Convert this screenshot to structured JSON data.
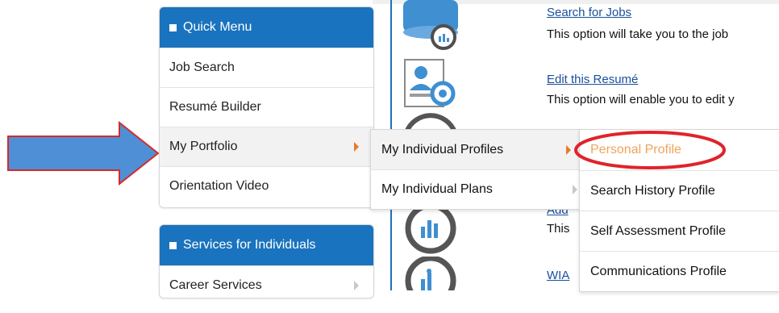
{
  "quick_menu": {
    "title": "Quick Menu",
    "items": [
      {
        "label": "Job Search"
      },
      {
        "label": "Resumé Builder"
      },
      {
        "label": "My Portfolio"
      },
      {
        "label": "Orientation Video"
      }
    ]
  },
  "services_menu": {
    "title": "Services for Individuals",
    "items": [
      {
        "label": "Career Services"
      }
    ]
  },
  "content": {
    "search_jobs": {
      "title": "Search for Jobs",
      "desc": "This option will take you to the job"
    },
    "edit_resume": {
      "title": "Edit this Resumé",
      "desc": "This option will enable you to edit y"
    },
    "add": {
      "title": "Add",
      "desc": "This"
    },
    "wia": {
      "title": "WIA"
    }
  },
  "submenu_portfolio": {
    "items": [
      {
        "label": "My Individual Profiles"
      },
      {
        "label": "My Individual Plans"
      }
    ]
  },
  "submenu_profiles": {
    "items": [
      {
        "label": "Personal Profile"
      },
      {
        "label": "Search History Profile"
      },
      {
        "label": "Self Assessment Profile"
      },
      {
        "label": "Communications Profile"
      }
    ]
  },
  "colors": {
    "header_blue": "#1a73be",
    "caret_orange": "#e8792b",
    "highlight_text": "#f0a35a",
    "annotation_red": "#e0232b",
    "arrow_blue": "#4f8fd6"
  }
}
